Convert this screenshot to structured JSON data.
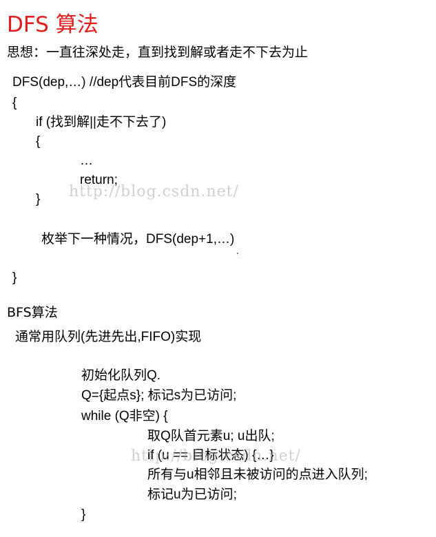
{
  "title": "DFS 算法",
  "subtitle": "思想：一直往深处走，直到找到解或者走不下去为止",
  "dfs_code": {
    "line1": "DFS(dep,…)  //dep代表目前DFS的深度",
    "line2": "{",
    "line3": "if (找到解||走不下去了)",
    "line4": "{",
    "line5": "…",
    "line6": "return;",
    "line7": "}",
    "line8": "枚举下一种情况，DFS(dep+1,…)",
    "line9": "}"
  },
  "bfs_title": "BFS算法",
  "bfs_intro": "通常用队列(先进先出,FIFO)实现",
  "bfs_code": {
    "line1": "初始化队列Q.",
    "line2": "Q={起点s}; 标记s为已访问;",
    "line3": "while (Q非空) {",
    "line4": "取Q队首元素u; u出队;",
    "line5": "if (u == 目标状态) {…}",
    "line6": "所有与u相邻且未被访问的点进入队列;",
    "line7": "标记u为已访问;",
    "line8": "}"
  },
  "watermark_1": "http://blog.csdn.net/",
  "watermark_2": "http://blog.csdn.net/"
}
